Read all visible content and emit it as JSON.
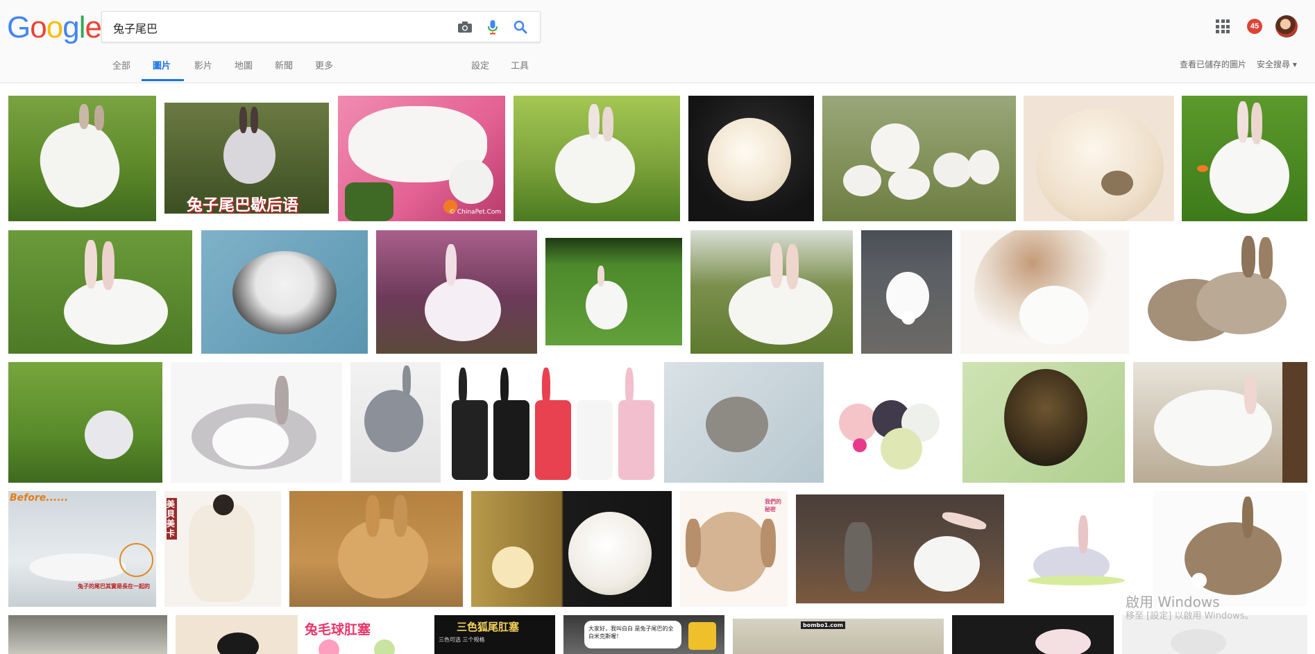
{
  "logo": {
    "G": "G",
    "o1": "o",
    "o2": "o",
    "g": "g",
    "l": "l",
    "e": "e"
  },
  "search": {
    "query": "兔子尾巴"
  },
  "icons": {
    "camera": "camera-icon",
    "mic": "microphone-icon",
    "search": "search-icon",
    "apps": "apps-grid-icon"
  },
  "account": {
    "notification_count": "45"
  },
  "tabs": [
    {
      "label": "全部",
      "active": false
    },
    {
      "label": "圖片",
      "active": true
    },
    {
      "label": "影片",
      "active": false
    },
    {
      "label": "地圖",
      "active": false
    },
    {
      "label": "新聞",
      "active": false
    },
    {
      "label": "更多",
      "active": false
    }
  ],
  "tools": {
    "settings": "設定",
    "tools": "工具"
  },
  "right_links": {
    "saved_images": "查看已儲存的圖片",
    "safe_search": "安全搜尋 ▾"
  },
  "captions": {
    "r1c2": "兔子尾巴歇后语",
    "r1c3": "© ChinaPet.Com",
    "r3c8": "",
    "r4c1a": "Before......",
    "r4c1b": "兔子的尾巴其實是長在一起的",
    "r4c2": "美貝美卡",
    "r4c6": "我們的秘密",
    "r5c2": "",
    "r5c3": "兔毛球肛塞",
    "r5c4": "三色狐尾肛塞",
    "r5c4b": "三色可选 三个规格",
    "r5c5": "大家好，我叫白白 是兔子尾巴的全白米克斯喔！",
    "r5c6": "bombo1.com"
  },
  "os_watermark": {
    "title": "啟用 Windows",
    "subtitle": "移至 [設定] 以啟用 Windows。"
  },
  "colors": {
    "accent": "#1a73e8",
    "badge": "#db4437"
  }
}
